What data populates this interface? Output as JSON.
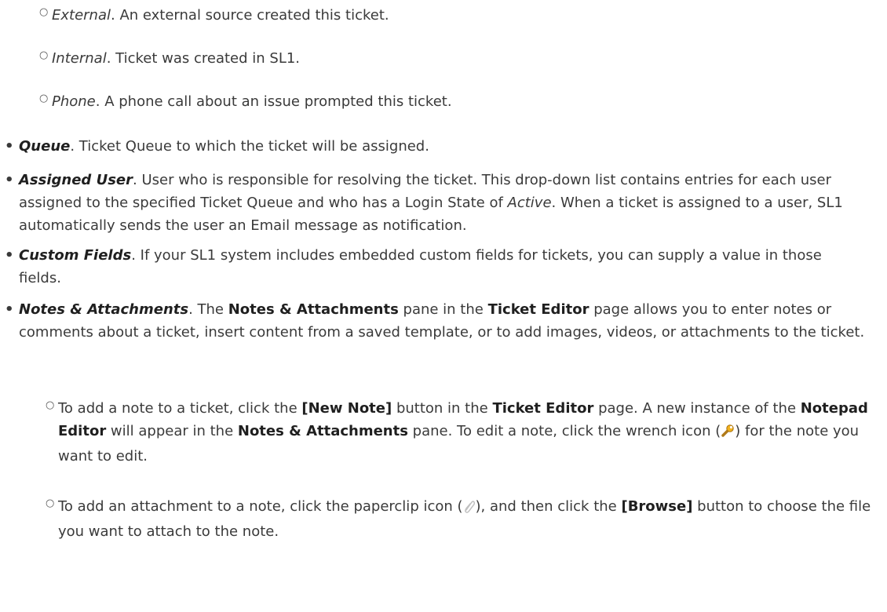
{
  "source_items": [
    {
      "term": "External",
      "desc": ". An external source created this ticket."
    },
    {
      "term": "Internal",
      "desc": ". Ticket was created in SL1."
    },
    {
      "term": "Phone",
      "desc": ". A phone call about an issue prompted this ticket."
    }
  ],
  "queue": {
    "term": "Queue",
    "desc": ". Ticket Queue to which the ticket will be assigned."
  },
  "assigned_user": {
    "term": "Assigned User",
    "desc_1": ". User who is responsible for resolving the ticket. This drop-down list contains entries for each user assigned to the specified Ticket Queue and who has a Login State of ",
    "active": "Active",
    "desc_2": ". When a ticket is assigned to a user, SL1 automatically sends the user an Email message as notification."
  },
  "custom_fields": {
    "term": "Custom Fields",
    "desc": ". If your SL1 system includes embedded custom fields for tickets, you can supply a value in those fields."
  },
  "notes": {
    "term": "Notes & Attachments",
    "p1": ". The ",
    "pane": "Notes & Attachments",
    "p2": " pane in the ",
    "editor": "Ticket Editor",
    "p3": " page allows you to enter notes or comments about a ticket, insert content from a saved template, or to add images, videos, or attachments to the ticket."
  },
  "note_steps": {
    "s1_a": "To add a note to a ticket, click the ",
    "s1_btn": "[New Note]",
    "s1_b": " button in the ",
    "s1_page": "Ticket Editor",
    "s1_c": " page. A new instance of the ",
    "s1_np": "Notepad Editor",
    "s1_d": " will appear in the ",
    "s1_pane": "Notes & Attachments",
    "s1_e": " pane. To edit a note, click the wrench icon (",
    "s1_f": ") for the note you want to edit.",
    "s2_a": "To add an attachment to a note, click the paperclip icon (",
    "s2_b": "), and then click the ",
    "s2_btn": "[Browse]",
    "s2_c": " button to choose the file you want to attach to the note."
  },
  "markers": {
    "sub": "○",
    "bullet": "•"
  },
  "icons": {
    "wrench": "wrench-icon",
    "paperclip": "paperclip-icon"
  }
}
